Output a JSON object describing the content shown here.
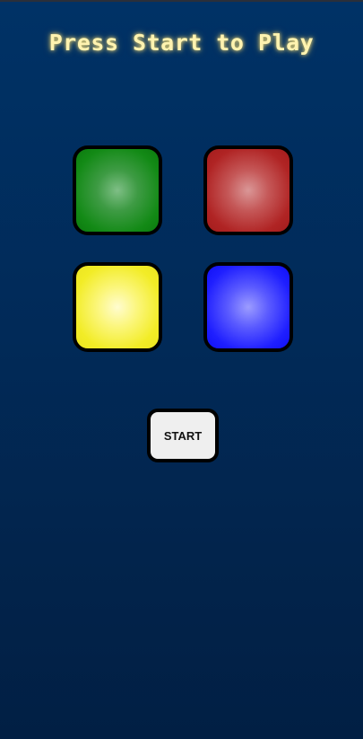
{
  "title": "Press Start to Play",
  "pads": [
    {
      "name": "green",
      "color": "#138a16"
    },
    {
      "name": "red",
      "color": "#b02424"
    },
    {
      "name": "yellow",
      "color": "#f2ec26"
    },
    {
      "name": "blue",
      "color": "#1f1fff"
    }
  ],
  "start_button": {
    "label": "START"
  },
  "colors": {
    "background_top": "#003266",
    "background_bottom": "#011f44",
    "title_glow": "#fff3b0"
  }
}
